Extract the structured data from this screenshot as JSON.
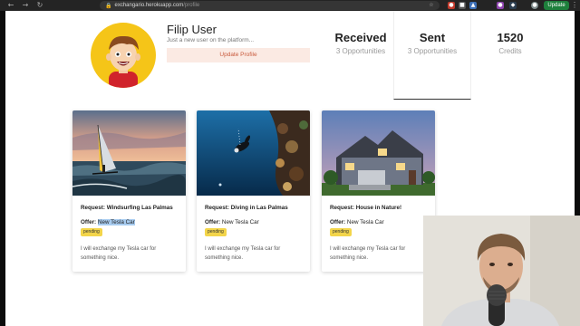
{
  "browser": {
    "url_host": "exchangario.herokuapp.com",
    "url_path": "/profile",
    "update_label": "Update"
  },
  "profile": {
    "name": "Filip User",
    "tagline": "Just a new user on the platform...",
    "update_button": "Update Profile"
  },
  "stats": [
    {
      "value": "Received",
      "label": "3 Opportunities"
    },
    {
      "value": "Sent",
      "label": "3 Opportunities"
    },
    {
      "value": "1520",
      "label": "Credits"
    }
  ],
  "cards": [
    {
      "request_label": "Request:",
      "request": "Windsurfing Las Palmas",
      "offer_label": "Offer:",
      "offer": "New Tesla Car",
      "status": "pending",
      "description": "I will exchange my Tesla car for something nice."
    },
    {
      "request_label": "Request:",
      "request": "Diving in Las Palmas",
      "offer_label": "Offer:",
      "offer": "New Tesla Car",
      "status": "pending",
      "description": "I will exchange my Tesla car for something nice."
    },
    {
      "request_label": "Request:",
      "request": "House in Nature!",
      "offer_label": "Offer:",
      "offer": "New Tesla Car",
      "status": "pending",
      "description": "I will exchange my Tesla car for something nice."
    }
  ],
  "colors": {
    "accent": "#c85a3c",
    "badge": "#f3d54a",
    "avatar_bg": "#f5c518"
  }
}
